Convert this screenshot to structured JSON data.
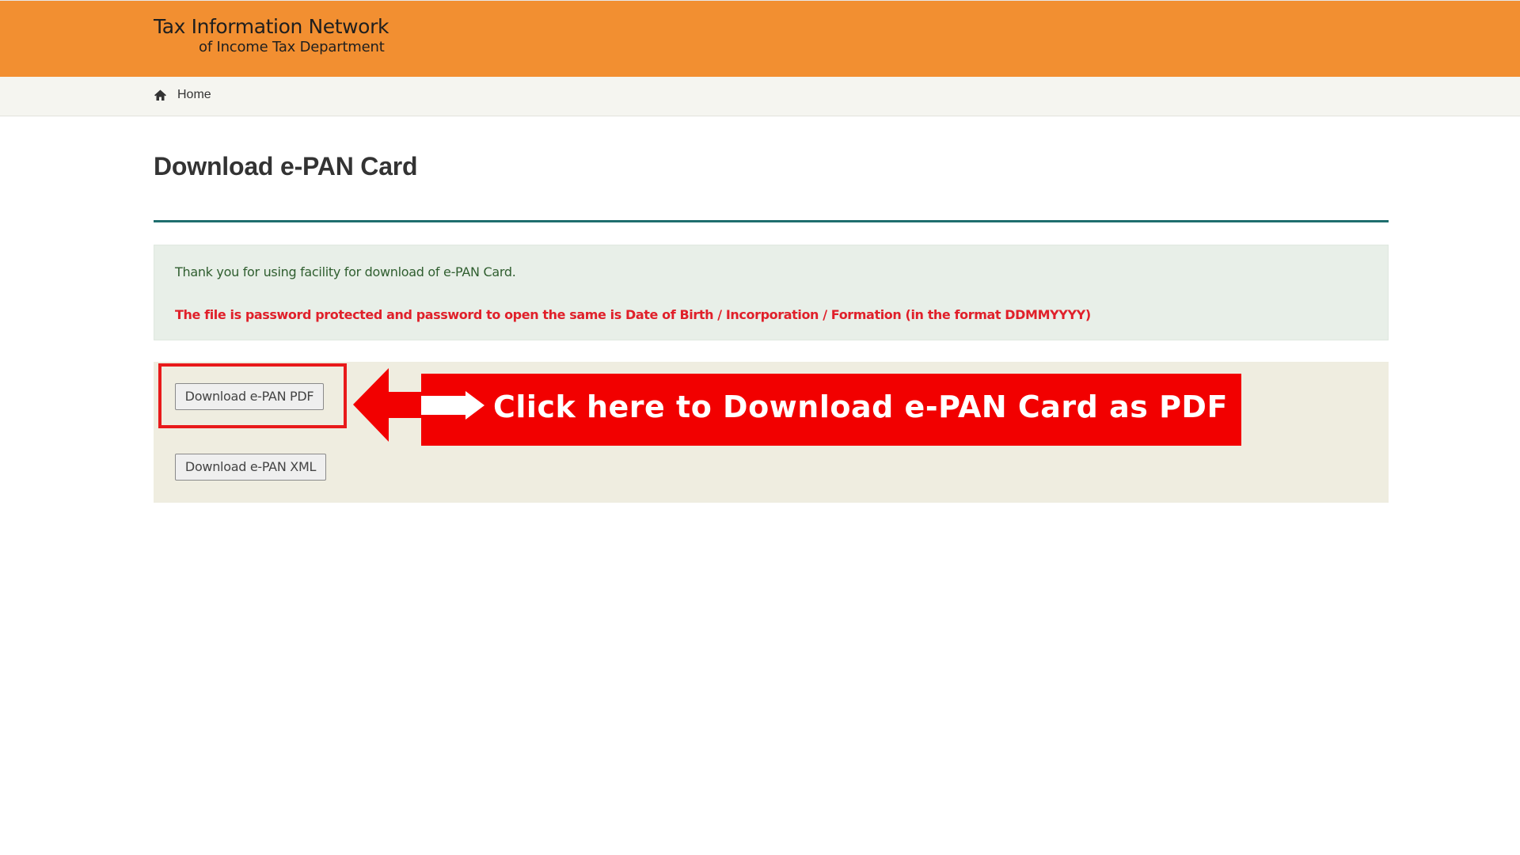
{
  "header": {
    "brand_line1": "Tax Information Network",
    "brand_line2": "of Income Tax Department",
    "background_color": "#f28f31"
  },
  "nav": {
    "home_icon": "home-icon",
    "home_label": "Home"
  },
  "page": {
    "title": "Download e-PAN Card"
  },
  "notice": {
    "message": "Thank you for using facility for download of e-PAN Card.",
    "password_note": "The file is password protected and password to open the same is Date of Birth / Incorporation / Formation (in the format DDMMYYYY)"
  },
  "actions": {
    "download_pdf_label": "Download e-PAN PDF",
    "download_xml_label": "Download e-PAN XML"
  },
  "callout": {
    "text": "Click here to Download e-PAN Card as PDF",
    "color": "#f20000"
  }
}
